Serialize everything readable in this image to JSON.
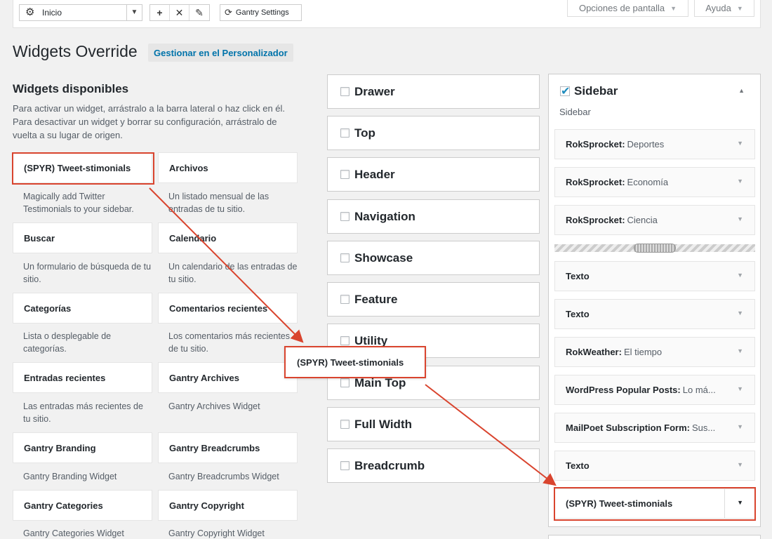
{
  "toolbar": {
    "select_value": "Inicio",
    "gantry_settings": "Gantry Settings",
    "screen_options": "Opciones de pantalla",
    "help": "Ayuda"
  },
  "page": {
    "title": "Widgets Override",
    "customizer_button": "Gestionar en el Personalizador"
  },
  "available": {
    "heading": "Widgets disponibles",
    "description": "Para activar un widget, arrástralo a la barra lateral o haz click en él. Para desactivar un widget y borrar su configuración, arrástralo de vuelta a su lugar de origen.",
    "widgets": [
      {
        "name": "(SPYR) Tweet-stimonials",
        "desc": "Magically add Twitter Testimonials to your sidebar."
      },
      {
        "name": "Archivos",
        "desc": "Un listado mensual de las entradas de tu sitio."
      },
      {
        "name": "Buscar",
        "desc": "Un formulario de búsqueda de tu sitio."
      },
      {
        "name": "Calendario",
        "desc": "Un calendario de las entradas de tu sitio."
      },
      {
        "name": "Categorías",
        "desc": "Lista o desplegable de categorías."
      },
      {
        "name": "Comentarios recientes",
        "desc": "Los comentarios más recientes de tu sitio."
      },
      {
        "name": "Entradas recientes",
        "desc": "Las entradas más recientes de tu sitio."
      },
      {
        "name": "Gantry Archives",
        "desc": "Gantry Archives Widget"
      },
      {
        "name": "Gantry Branding",
        "desc": "Gantry Branding Widget"
      },
      {
        "name": "Gantry Breadcrumbs",
        "desc": "Gantry Breadcrumbs Widget"
      },
      {
        "name": "Gantry Categories",
        "desc": "Gantry Categories Widget"
      },
      {
        "name": "Gantry Copyright",
        "desc": "Gantry Copyright Widget"
      }
    ]
  },
  "positions": [
    "Drawer",
    "Top",
    "Header",
    "Navigation",
    "Showcase",
    "Feature",
    "Utility",
    "Main Top",
    "Full Width",
    "Breadcrumb"
  ],
  "sidebar": {
    "title": "Sidebar",
    "subtitle": "Sidebar",
    "items": [
      {
        "type": "RokSprocket:",
        "title": "Deportes"
      },
      {
        "type": "RokSprocket:",
        "title": "Economía"
      },
      {
        "type": "RokSprocket:",
        "title": "Ciencia"
      },
      {
        "type": "Texto",
        "title": ""
      },
      {
        "type": "Texto",
        "title": ""
      },
      {
        "type": "RokWeather:",
        "title": "El tiempo"
      },
      {
        "type": "WordPress Popular Posts:",
        "title": "Lo má..."
      },
      {
        "type": "MailPoet Subscription Form:",
        "title": "Sus..."
      },
      {
        "type": "Texto",
        "title": ""
      },
      {
        "type": "(SPYR) Tweet-stimonials",
        "title": ""
      }
    ]
  },
  "dragging": {
    "label": "(SPYR) Tweet-stimonials"
  },
  "colors": {
    "annotation": "#d9442e",
    "link": "#0073aa"
  }
}
